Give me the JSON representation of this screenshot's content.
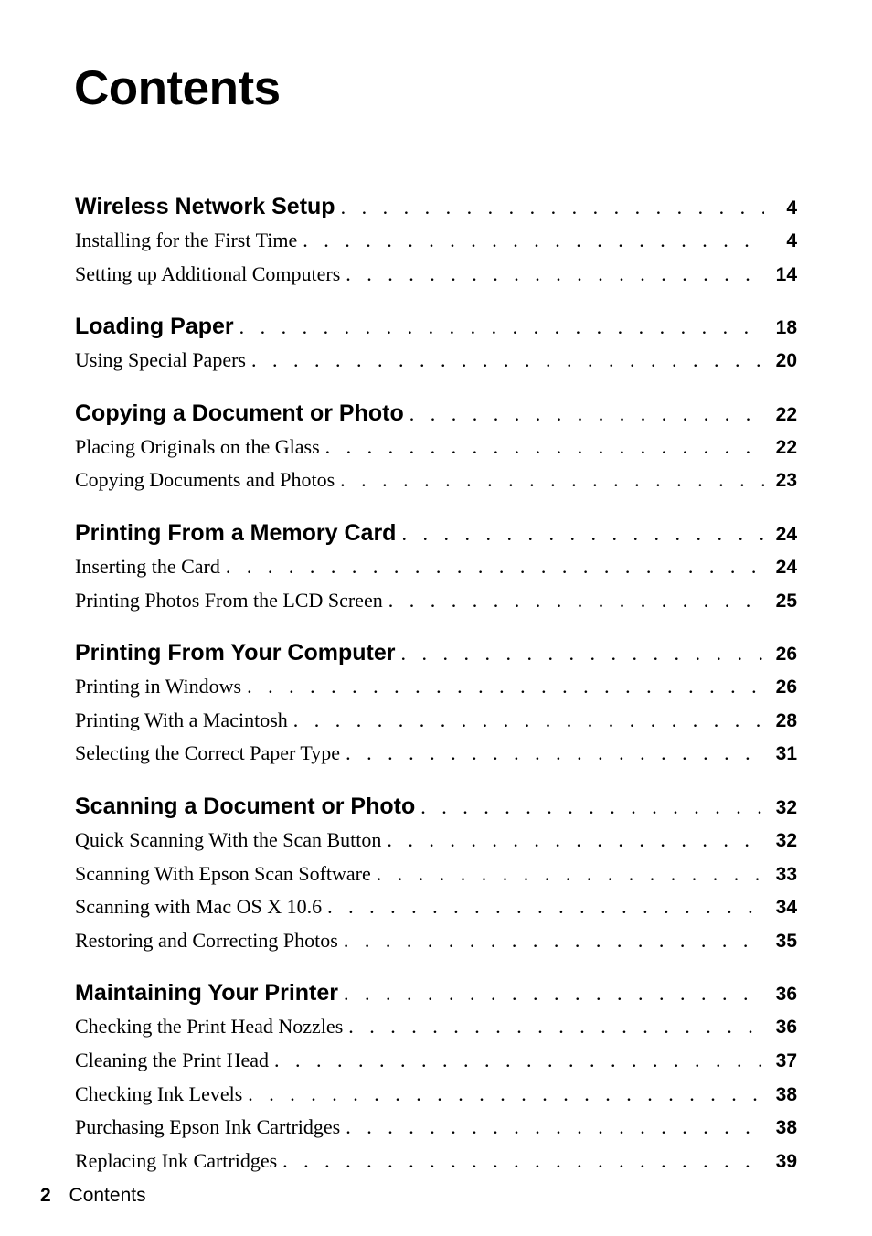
{
  "title": "Contents",
  "sections": [
    {
      "title": "Wireless Network Setup",
      "page": "4",
      "items": [
        {
          "label": "Installing for the First Time",
          "page": "4"
        },
        {
          "label": "Setting up Additional Computers",
          "page": "14"
        }
      ]
    },
    {
      "title": "Loading Paper",
      "page": "18",
      "items": [
        {
          "label": "Using Special Papers",
          "page": "20"
        }
      ]
    },
    {
      "title": "Copying a Document or Photo",
      "page": "22",
      "items": [
        {
          "label": "Placing Originals on the Glass",
          "page": "22"
        },
        {
          "label": "Copying Documents and Photos",
          "page": "23"
        }
      ]
    },
    {
      "title": "Printing From a Memory Card",
      "page": "24",
      "items": [
        {
          "label": "Inserting the Card",
          "page": "24"
        },
        {
          "label": "Printing Photos From the LCD Screen",
          "page": "25"
        }
      ]
    },
    {
      "title": "Printing From Your Computer",
      "page": "26",
      "items": [
        {
          "label": "Printing in Windows",
          "page": "26"
        },
        {
          "label": "Printing With a Macintosh",
          "page": "28"
        },
        {
          "label": "Selecting the Correct Paper Type",
          "page": "31"
        }
      ]
    },
    {
      "title": "Scanning a Document or Photo",
      "page": "32",
      "items": [
        {
          "label": "Quick Scanning With the Scan Button",
          "page": "32"
        },
        {
          "label": "Scanning With Epson Scan Software",
          "page": "33"
        },
        {
          "label": "Scanning with Mac OS X 10.6",
          "page": "34"
        },
        {
          "label": "Restoring and Correcting Photos",
          "page": "35"
        }
      ]
    },
    {
      "title": "Maintaining Your Printer",
      "page": "36",
      "items": [
        {
          "label": "Checking the Print Head Nozzles",
          "page": "36"
        },
        {
          "label": "Cleaning the Print Head",
          "page": "37"
        },
        {
          "label": "Checking Ink Levels",
          "page": "38"
        },
        {
          "label": "Purchasing Epson Ink Cartridges",
          "page": "38"
        },
        {
          "label": "Replacing Ink Cartridges",
          "page": "39"
        }
      ]
    }
  ],
  "footer": {
    "page_number": "2",
    "label": "Contents"
  }
}
